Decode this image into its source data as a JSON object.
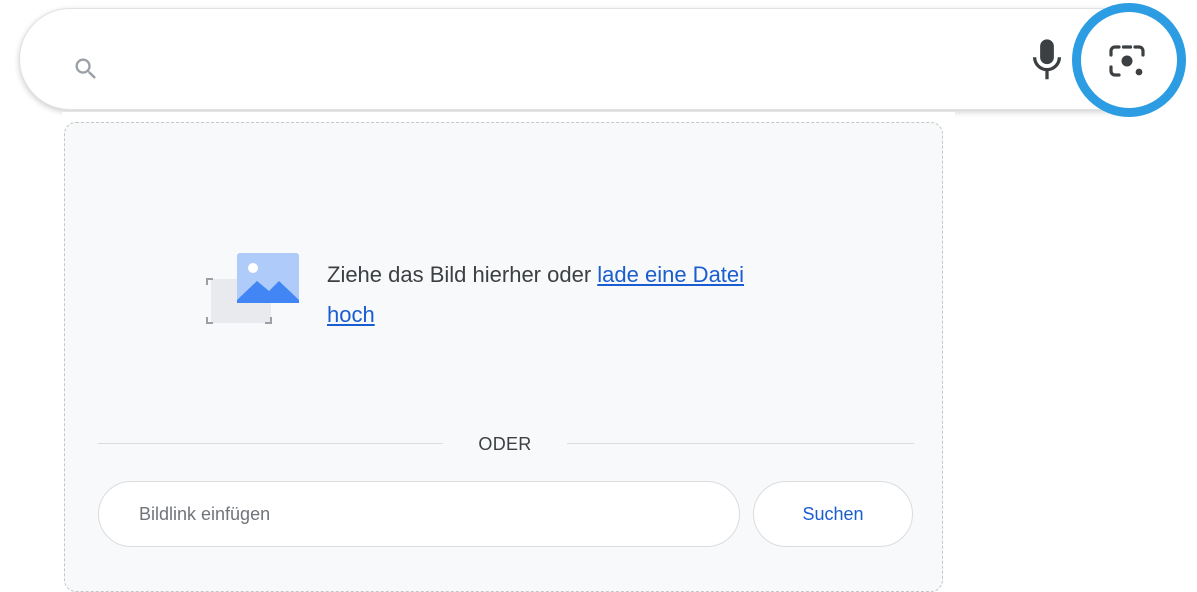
{
  "search": {
    "value": "",
    "icons": {
      "search": "search-icon",
      "mic": "microphone-icon",
      "lens": "camera-lens-icon"
    }
  },
  "upload_panel": {
    "drop_text": "Ziehe das Bild hierher oder ",
    "upload_link": "lade eine Datei hoch",
    "separator": "ODER",
    "url_placeholder": "Bildlink einfügen",
    "submit_label": "Suchen"
  },
  "colors": {
    "highlight_ring": "#2d9de3",
    "link": "#1a5dd0",
    "panel_background": "#f8f9fa"
  }
}
